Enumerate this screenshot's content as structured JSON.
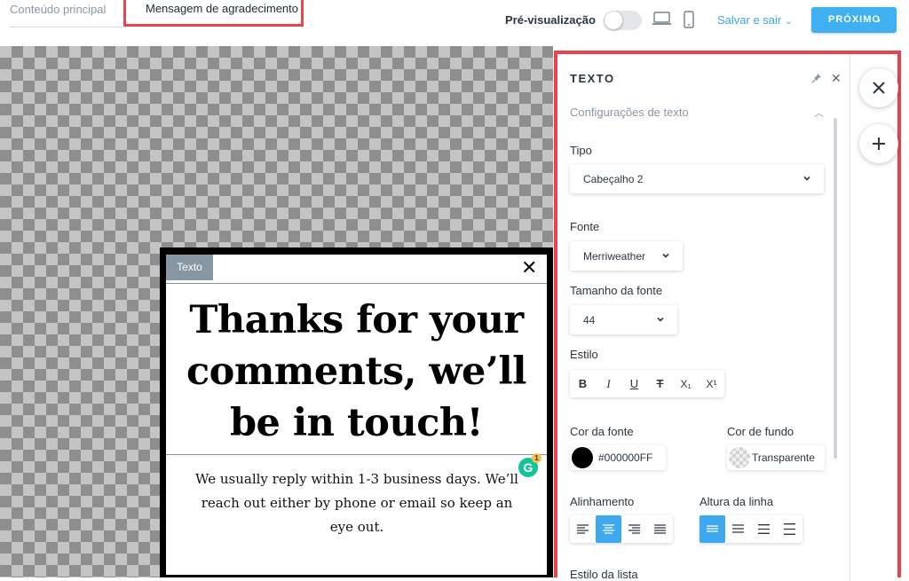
{
  "topbar": {
    "tab_main": "Conteúdo principal",
    "tab_thanks": "Mensagem de agradecimento",
    "preview_label": "Pré-visualização",
    "save_exit": "Salvar e sair",
    "next": "PRÓXIMO",
    "icons": [
      "desktop-icon",
      "mobile-icon"
    ]
  },
  "popup": {
    "tag": "Texto",
    "close": "✕",
    "headline": "Thanks for your comments, we’ll be in touch!",
    "body": "We usually reply within 1-3 business days. We’ll reach out either by phone or email so keep an eye out.",
    "grammarly_letter": "G",
    "grammarly_count": "1"
  },
  "panel": {
    "title": "TEXTO",
    "section": "Configurações de texto",
    "tipo_label": "Tipo",
    "tipo_value": "Cabeçalho 2",
    "fonte_label": "Fonte",
    "fonte_value": "Merriweather",
    "size_label": "Tamanho da fonte",
    "size_value": "44",
    "estilo_label": "Estilo",
    "style_buttons": [
      "B",
      "I",
      "U",
      "T",
      "X₁",
      "X¹"
    ],
    "font_color_label": "Cor da fonte",
    "font_color_value": "#000000FF",
    "bg_color_label": "Cor de fundo",
    "bg_color_value": "Transparente",
    "align_label": "Alinhamento",
    "line_height_label": "Altura da linha",
    "list_style_label": "Estilo da lista"
  },
  "colors": {
    "accent": "#3fa9f0",
    "highlight_border": "#e8444c",
    "font_color": "#000000"
  }
}
